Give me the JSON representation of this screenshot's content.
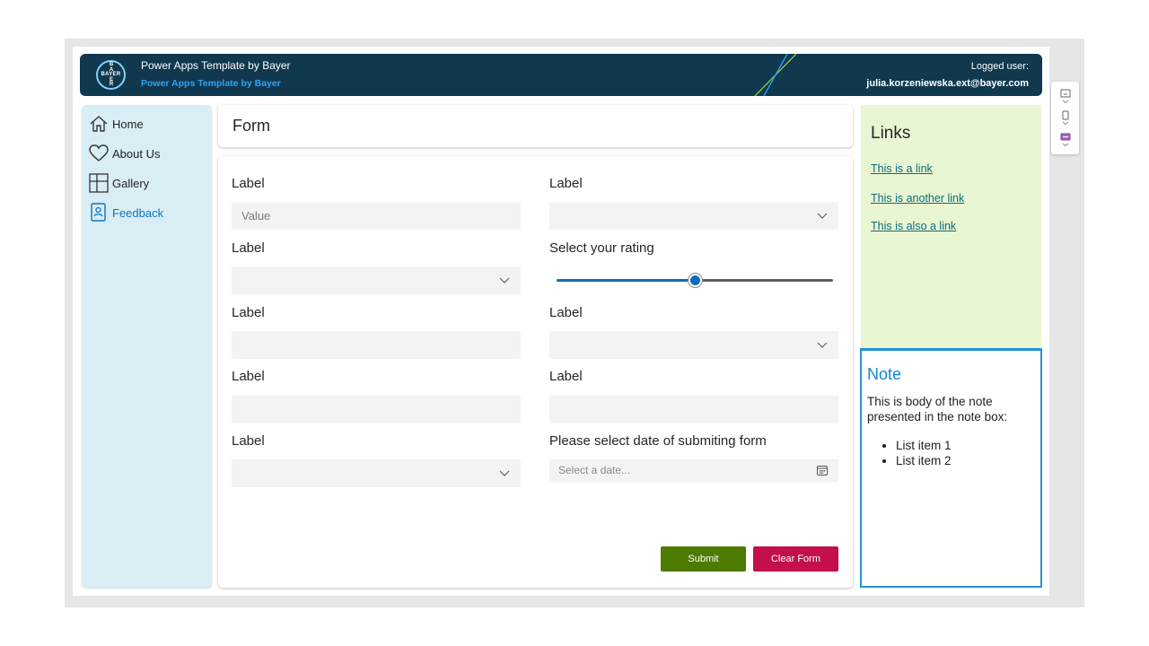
{
  "header": {
    "title": "Power Apps Template by Bayer",
    "subtitle": "Power Apps Template by Bayer",
    "logo_text": "BAYER",
    "logged_label": "Logged user:",
    "user_email": "julia.korzeniewska.ext@bayer.com"
  },
  "sidebar": {
    "items": [
      {
        "label": "Home",
        "icon": "home-icon"
      },
      {
        "label": "About Us",
        "icon": "heart-icon"
      },
      {
        "label": "Gallery",
        "icon": "gallery-icon"
      },
      {
        "label": "Feedback",
        "icon": "feedback-icon"
      }
    ]
  },
  "form": {
    "title": "Form",
    "fields": [
      {
        "label": "Label",
        "value": "Value"
      },
      {
        "label": "Label",
        "value": ""
      },
      {
        "label": "Label",
        "value": ""
      },
      {
        "label": "Select your rating"
      },
      {
        "label": "Label",
        "value": ""
      },
      {
        "label": "Label",
        "value": ""
      },
      {
        "label": "Label",
        "value": ""
      },
      {
        "label": "Label",
        "value": ""
      },
      {
        "label": "Label",
        "value": ""
      },
      {
        "label": "Please select date of submiting form",
        "placeholder": "Select a date..."
      }
    ],
    "rating_fraction": 0.5,
    "submit_label": "Submit",
    "clear_label": "Clear Form"
  },
  "links": {
    "title": "Links",
    "items": [
      "This is a link",
      "This is another link",
      "This is also a link"
    ]
  },
  "note": {
    "title": "Note",
    "body": "This is body of the note presented in the note box:",
    "items": [
      "List item 1",
      "List item 2"
    ]
  },
  "colors": {
    "header_bg": "#10384f",
    "sidebar_bg": "#d9edf5",
    "links_bg": "#e9f6d3",
    "accent_blue": "#0f6cbd",
    "submit_green": "#4c7b00",
    "clear_red": "#c30f4c"
  }
}
